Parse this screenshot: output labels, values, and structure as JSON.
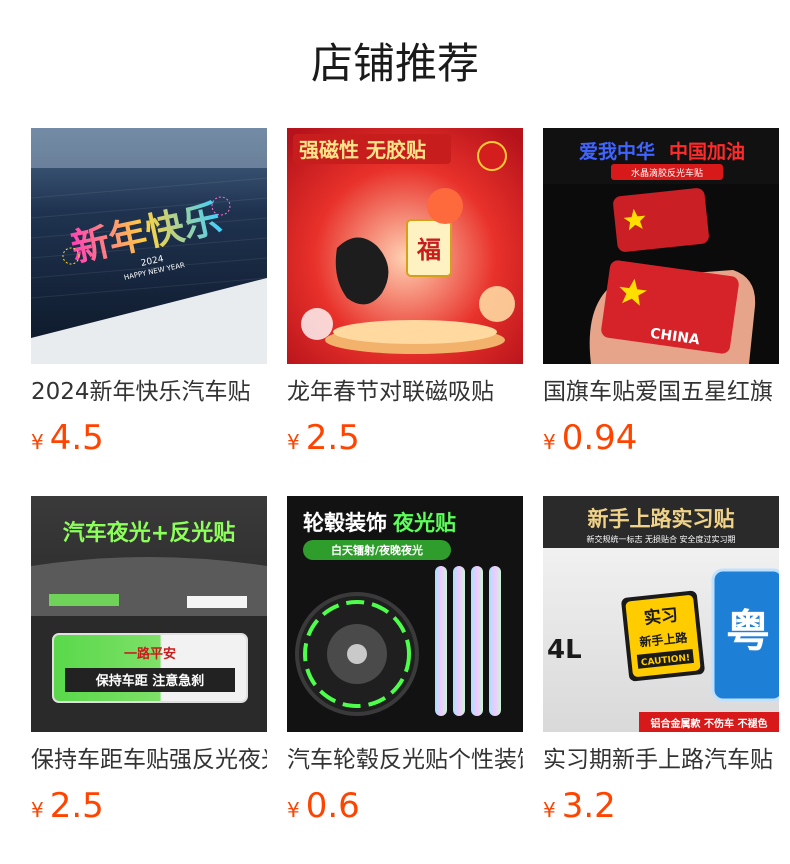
{
  "page": {
    "title": "店铺推荐"
  },
  "currency_symbol": "¥",
  "colors": {
    "price": "#ff4400",
    "title": "#1a1a1a",
    "name": "#333333"
  },
  "products": [
    {
      "name": "2024新年快乐汽车贴",
      "price": "4.5",
      "image_text": {
        "main": "新年快乐",
        "sub1": "2024",
        "sub2": "HAPPY NEW YEAR"
      }
    },
    {
      "name": "龙年春节对联磁吸贴",
      "price": "2.5",
      "image_text": {
        "headline": "强磁性 无胶贴",
        "badge": "福"
      }
    },
    {
      "name": "国旗车贴爱国五星红旗",
      "price": "0.94",
      "image_text": {
        "headline_a": "爱我中华",
        "headline_b": "中国加油",
        "sub": "水晶滴胶反光车贴",
        "card": "CHINA"
      }
    },
    {
      "name": "保持车距车贴强反光夜光",
      "price": "2.5",
      "image_text": {
        "headline": "汽车夜光+反光贴",
        "sign_top": "一路平安",
        "sign_bottom": "保持车距 注意急刹"
      }
    },
    {
      "name": "汽车轮毂反光贴个性装饰",
      "price": "0.6",
      "image_text": {
        "headline_a": "轮毂装饰",
        "headline_b": "夜光贴",
        "sub": "白天镭射/夜晚夜光"
      }
    },
    {
      "name": "实习期新手上路汽车贴",
      "price": "3.2",
      "image_text": {
        "headline": "新手上路实习贴",
        "sub": "新交规统一标志 无损贴合 安全度过实习期",
        "sign_a": "实习",
        "sign_b": "新手上路",
        "sign_c": "CAUTION!",
        "plate": "4L",
        "plate_char": "粤",
        "footer": "铝合金属款 不伤车 不褪色"
      }
    }
  ]
}
